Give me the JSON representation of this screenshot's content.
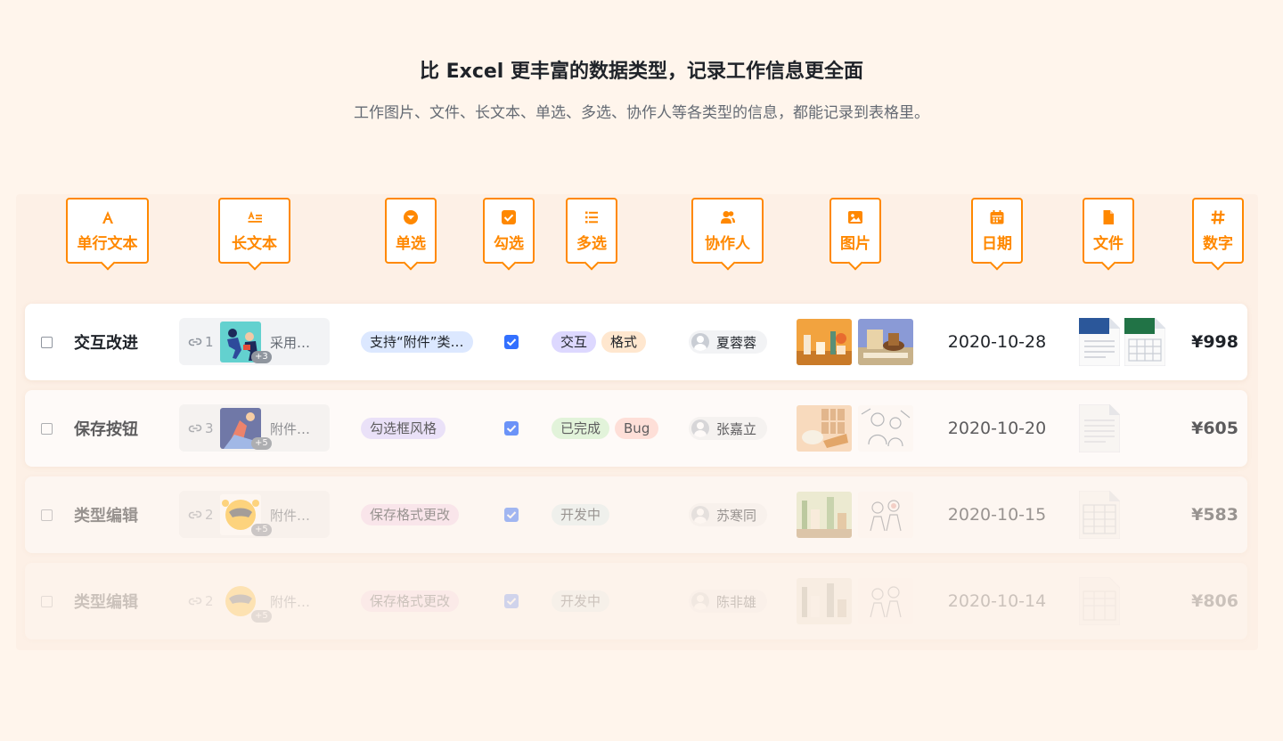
{
  "header": {
    "title": "比 Excel 更丰富的数据类型，记录工作信息更全面",
    "subtitle": "工作图片、文件、长文本、单选、多选、协作人等各类型的信息，都能记录到表格里。"
  },
  "colors": {
    "accent": "#ff8800",
    "checkbox": "#3370ff",
    "background": "#fff5ec"
  },
  "field_types": [
    {
      "label": "单行文本",
      "icon": "text-a-icon"
    },
    {
      "label": "长文本",
      "icon": "long-text-icon"
    },
    {
      "label": "单选",
      "icon": "single-select-icon"
    },
    {
      "label": "勾选",
      "icon": "checkbox-icon"
    },
    {
      "label": "多选",
      "icon": "multi-select-icon"
    },
    {
      "label": "协作人",
      "icon": "people-icon"
    },
    {
      "label": "图片",
      "icon": "image-icon"
    },
    {
      "label": "日期",
      "icon": "calendar-icon"
    },
    {
      "label": "文件",
      "icon": "file-icon"
    },
    {
      "label": "数字",
      "icon": "hash-icon"
    }
  ],
  "rows": [
    {
      "title": "交互改进",
      "link_count": "1",
      "more": "+3",
      "long_text": "采用…",
      "single": "支持“附件”类…",
      "multi": [
        "交互",
        "格式"
      ],
      "person": "夏蓉蓉",
      "date": "2020-10-28",
      "number": "¥998"
    },
    {
      "title": "保存按钮",
      "link_count": "3",
      "more": "+5",
      "long_text": "附件…",
      "single": "勾选框风格",
      "multi": [
        "已完成",
        "Bug"
      ],
      "person": "张嘉立",
      "date": "2020-10-20",
      "number": "¥605"
    },
    {
      "title": "类型编辑",
      "link_count": "2",
      "more": "+5",
      "long_text": "附件…",
      "single": "保存格式更改",
      "multi": [
        "开发中"
      ],
      "person": "苏寒同",
      "date": "2020-10-15",
      "number": "¥583"
    },
    {
      "title": "类型编辑",
      "link_count": "2",
      "more": "+5",
      "long_text": "附件…",
      "single": "保存格式更改",
      "multi": [
        "开发中"
      ],
      "person": "陈非雄",
      "date": "2020-10-14",
      "number": "¥806"
    }
  ]
}
